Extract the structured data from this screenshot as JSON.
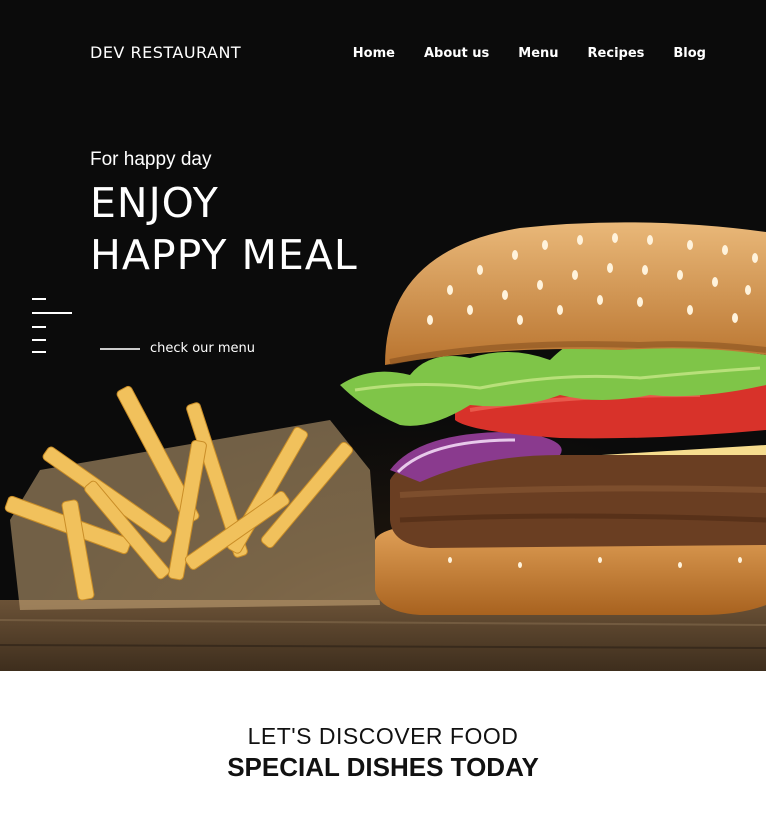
{
  "brand": "DEV RESTAURANT",
  "nav": {
    "items": [
      "Home",
      "About us",
      "Menu",
      "Recipes",
      "Blog"
    ]
  },
  "hero": {
    "subtitle": "For happy day",
    "title_line1": "ENJOY",
    "title_line2": "HAPPY MEAL",
    "cta_label": "check our menu",
    "image_desc": "burger-and-fries-photo"
  },
  "discover": {
    "kicker": "LET'S DISCOVER FOOD",
    "heading": "SPECIAL DISHES TODAY"
  },
  "colors": {
    "hero_bg": "#0b0b0b",
    "text_light": "#ffffff",
    "text_dark": "#111111"
  }
}
